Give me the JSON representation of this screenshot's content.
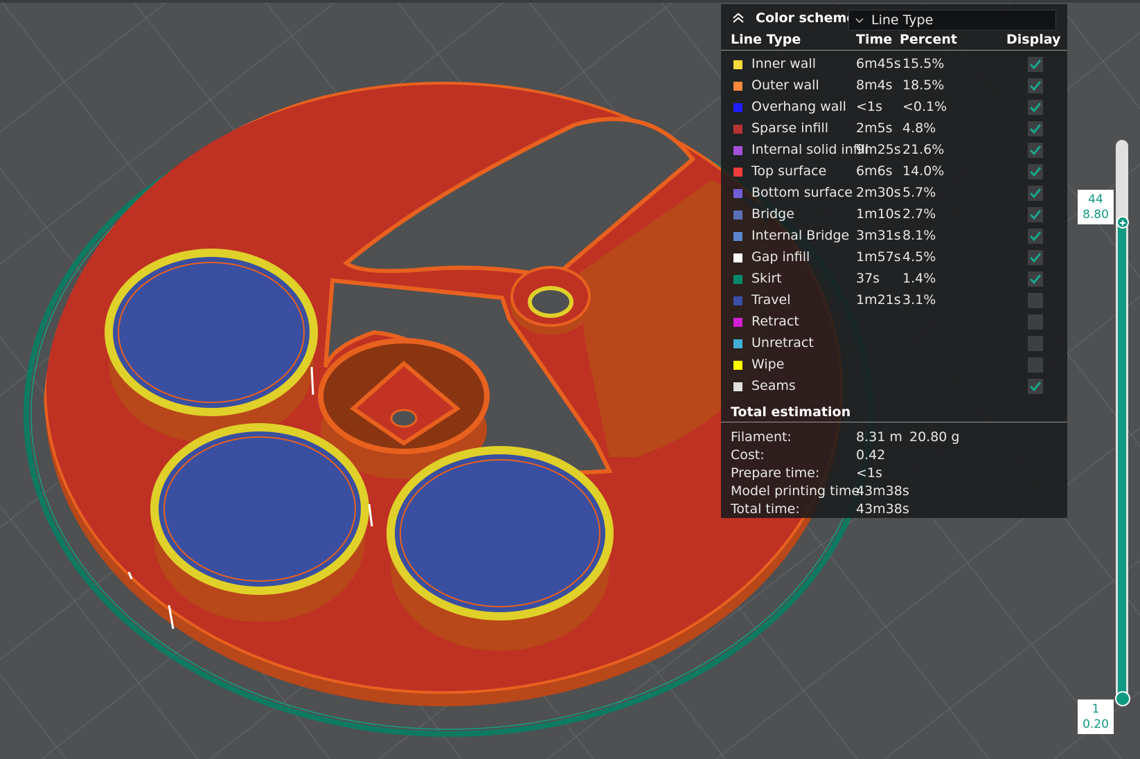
{
  "color_scheme": {
    "label": "Color scheme",
    "selected": "Line Type",
    "collapse_icon": "double-chevron-up-icon",
    "dropdown_icon": "chevron-down-icon"
  },
  "legend": {
    "headers": {
      "name": "Line Type",
      "time": "Time",
      "percent": "Percent",
      "display": "Display"
    },
    "rows": [
      {
        "name": "Inner wall",
        "time": "6m45s",
        "percent": "15.5%",
        "color": "#f7da3c",
        "display": true
      },
      {
        "name": "Outer wall",
        "time": "8m4s",
        "percent": "18.5%",
        "color": "#f7883c",
        "display": true
      },
      {
        "name": "Overhang wall",
        "time": "<1s",
        "percent": "<0.1%",
        "color": "#1e1eff",
        "display": true
      },
      {
        "name": "Sparse infill",
        "time": "2m5s",
        "percent": "4.8%",
        "color": "#b73232",
        "display": true
      },
      {
        "name": "Internal solid infill",
        "time": "9m25s",
        "percent": "21.6%",
        "color": "#a352d8",
        "display": true
      },
      {
        "name": "Top surface",
        "time": "6m6s",
        "percent": "14.0%",
        "color": "#f23c3c",
        "display": true
      },
      {
        "name": "Bottom surface",
        "time": "2m30s",
        "percent": "5.7%",
        "color": "#6f5ed6",
        "display": true
      },
      {
        "name": "Bridge",
        "time": "1m10s",
        "percent": "2.7%",
        "color": "#5a6fb8",
        "display": true
      },
      {
        "name": "Internal Bridge",
        "time": "3m31s",
        "percent": "8.1%",
        "color": "#5c85cf",
        "display": true
      },
      {
        "name": "Gap infill",
        "time": "1m57s",
        "percent": "4.5%",
        "color": "#ffffff",
        "display": true
      },
      {
        "name": "Skirt",
        "time": "37s",
        "percent": "1.4%",
        "color": "#008a6b",
        "display": true
      },
      {
        "name": "Travel",
        "time": "1m21s",
        "percent": "3.1%",
        "color": "#3a4fa8",
        "display": false
      },
      {
        "name": "Retract",
        "time": "",
        "percent": "",
        "color": "#d41ed4",
        "display": false
      },
      {
        "name": "Unretract",
        "time": "",
        "percent": "",
        "color": "#40b0d8",
        "display": false
      },
      {
        "name": "Wipe",
        "time": "",
        "percent": "",
        "color": "#ffff00",
        "display": false
      },
      {
        "name": "Seams",
        "time": "",
        "percent": "",
        "color": "#e0e0e0",
        "display": true
      }
    ]
  },
  "total_estimation": {
    "title": "Total estimation",
    "filament_label": "Filament:",
    "filament_length": "8.31 m",
    "filament_weight": "20.80 g",
    "cost_label": "Cost:",
    "cost": "0.42",
    "prepare_label": "Prepare time:",
    "prepare": "<1s",
    "model_time_label": "Model printing time:",
    "model_time": "43m38s",
    "total_label": "Total time:",
    "total": "43m38s"
  },
  "layer_slider": {
    "top_layer": "44",
    "top_height": "8.80",
    "bottom_layer": "1",
    "bottom_height": "0.20",
    "accent_color": "#109a82"
  },
  "colors": {
    "background": "#4e5052",
    "infill_red": "#bf2f22",
    "wall_orange": "#d9561c",
    "wall_yellow": "#e0d02a",
    "skirt_green": "#0e7a62",
    "bottom_blue": "#3a4fa0"
  }
}
